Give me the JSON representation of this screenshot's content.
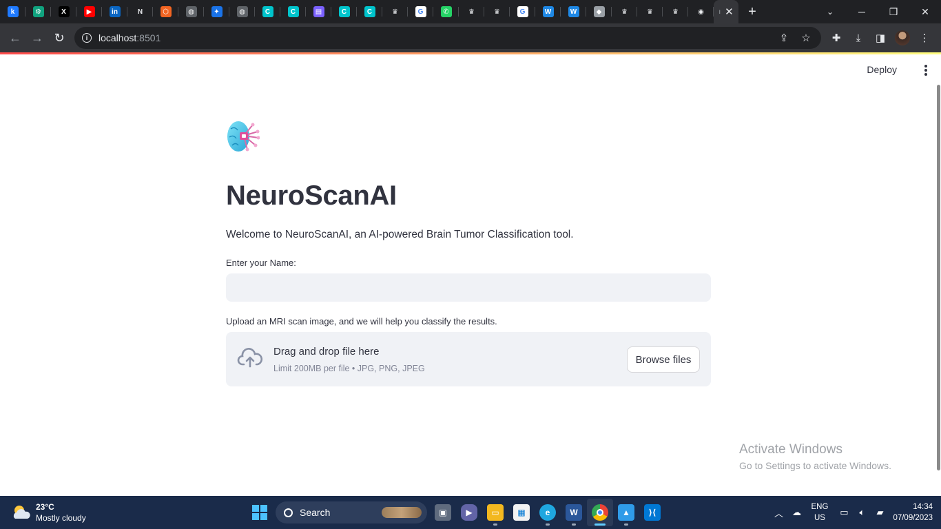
{
  "browser": {
    "tabs": [
      {
        "icon": "k-icon",
        "glyph": "k",
        "color": "#1f7aff"
      },
      {
        "icon": "chatgpt-icon",
        "glyph": "⚙",
        "color": "#10a37f"
      },
      {
        "icon": "x-icon",
        "glyph": "X",
        "color": "#000000"
      },
      {
        "icon": "youtube-icon",
        "glyph": "▶",
        "color": "#ff0000"
      },
      {
        "icon": "linkedin-icon",
        "glyph": "in",
        "color": "#0a66c2"
      },
      {
        "icon": "notion-icon",
        "glyph": "N",
        "color": "#202124"
      },
      {
        "icon": "hexagon-icon",
        "glyph": "⬡",
        "color": "#f26522"
      },
      {
        "icon": "globe-icon",
        "glyph": "◍",
        "color": "#5f6368"
      },
      {
        "icon": "compass-icon",
        "glyph": "✦",
        "color": "#1a73e8"
      },
      {
        "icon": "globe-icon",
        "glyph": "◍",
        "color": "#5f6368"
      },
      {
        "icon": "canva-icon",
        "glyph": "C",
        "color": "#00c4cc"
      },
      {
        "icon": "canva-icon",
        "glyph": "C",
        "color": "#00c4cc"
      },
      {
        "icon": "app-icon",
        "glyph": "▤",
        "color": "#7b61ff"
      },
      {
        "icon": "canva-icon",
        "glyph": "C",
        "color": "#00c4cc"
      },
      {
        "icon": "canva-icon",
        "glyph": "C",
        "color": "#00c4cc"
      },
      {
        "icon": "crown-icon",
        "glyph": "♛",
        "color": "#202124"
      },
      {
        "icon": "google-icon",
        "glyph": "G",
        "color": "#ffffff"
      },
      {
        "icon": "whatsapp-icon",
        "glyph": "✆",
        "color": "#25d366"
      },
      {
        "icon": "crown-icon",
        "glyph": "♛",
        "color": "#202124"
      },
      {
        "icon": "crown-icon",
        "glyph": "♛",
        "color": "#202124"
      },
      {
        "icon": "google-icon",
        "glyph": "G",
        "color": "#ffffff"
      },
      {
        "icon": "w-icon",
        "glyph": "W",
        "color": "#1e88e5"
      },
      {
        "icon": "w-icon",
        "glyph": "W",
        "color": "#1e88e5"
      },
      {
        "icon": "layers-icon",
        "glyph": "◆",
        "color": "#9aa0a6"
      },
      {
        "icon": "crown-icon",
        "glyph": "♛",
        "color": "#202124"
      },
      {
        "icon": "crown-icon",
        "glyph": "♛",
        "color": "#202124"
      },
      {
        "icon": "crown-icon",
        "glyph": "♛",
        "color": "#202124"
      },
      {
        "icon": "chrome-icon",
        "glyph": "◉",
        "color": "#202124"
      }
    ],
    "active_tab_glyph": "ı",
    "url_host": "localhost",
    "url_port": ":8501",
    "accent_gradient": [
      "#ff4b4b",
      "#fffd80"
    ]
  },
  "app": {
    "deploy_label": "Deploy",
    "title": "NeuroScanAI",
    "welcome": "Welcome to NeuroScanAI, an AI-powered Brain Tumor Classification tool.",
    "name_label": "Enter your Name:",
    "name_value": "",
    "upload_label": "Upload an MRI scan image, and we will help you classify the results.",
    "drop_title": "Drag and drop file here",
    "drop_sub": "Limit 200MB per file • JPG, PNG, JPEG",
    "browse_label": "Browse files"
  },
  "watermark": {
    "line1": "Activate Windows",
    "line2": "Go to Settings to activate Windows."
  },
  "taskbar": {
    "temperature": "23°C",
    "weather": "Mostly cloudy",
    "search_label": "Search",
    "lang_line1": "ENG",
    "lang_line2": "US",
    "time": "14:34",
    "date": "07/09/2023"
  }
}
